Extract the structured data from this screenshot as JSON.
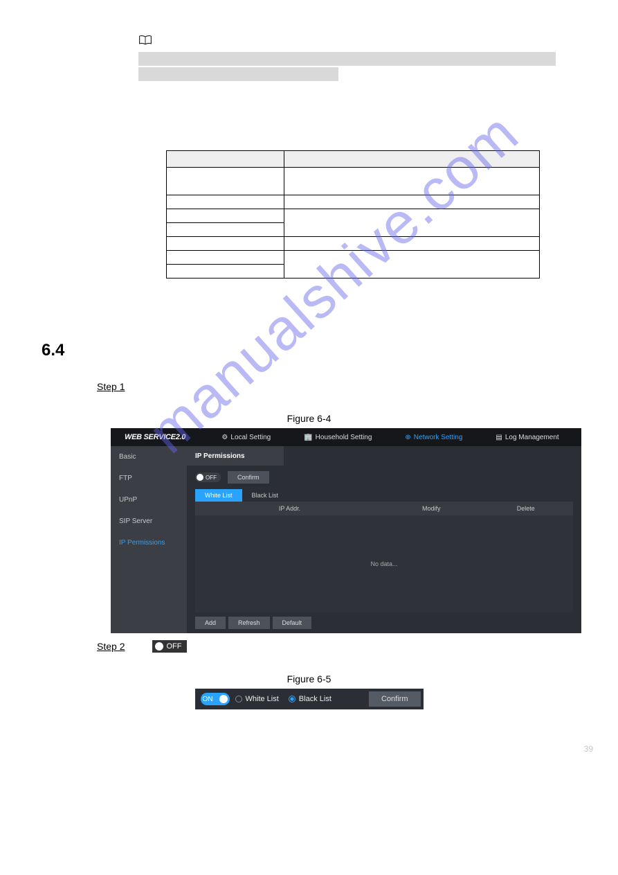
{
  "note": {
    "icon": "book-icon"
  },
  "table": {
    "header_param": "",
    "header_desc": ""
  },
  "section": {
    "number": "6.4",
    "title": ""
  },
  "steps": {
    "step1": "Step 1",
    "step2": "Step 2"
  },
  "figure64": {
    "caption": "Figure 6-4",
    "logo": "WEB SERVICE2.0",
    "tabs": {
      "local": "Local Setting",
      "household": "Household Setting",
      "network": "Network Setting",
      "log": "Log Management"
    },
    "sidebar": {
      "basic": "Basic",
      "ftp": "FTP",
      "upnp": "UPnP",
      "sip": "SIP Server",
      "ip_permissions": "IP Permissions"
    },
    "panel_title": "IP Permissions",
    "switch_off": "OFF",
    "confirm": "Confirm",
    "list_tabs": {
      "white": "White List",
      "black": "Black List"
    },
    "table_headers": {
      "ip": "IP Addr.",
      "modify": "Modify",
      "delete": "Delete"
    },
    "no_data": "No data...",
    "footer_buttons": {
      "add": "Add",
      "refresh": "Refresh",
      "default": "Default"
    }
  },
  "step2_off_chip": "OFF",
  "figure65": {
    "caption": "Figure 6-5",
    "on": "ON",
    "white": "White List",
    "black": "Black List",
    "confirm": "Confirm"
  },
  "page_number": "39"
}
